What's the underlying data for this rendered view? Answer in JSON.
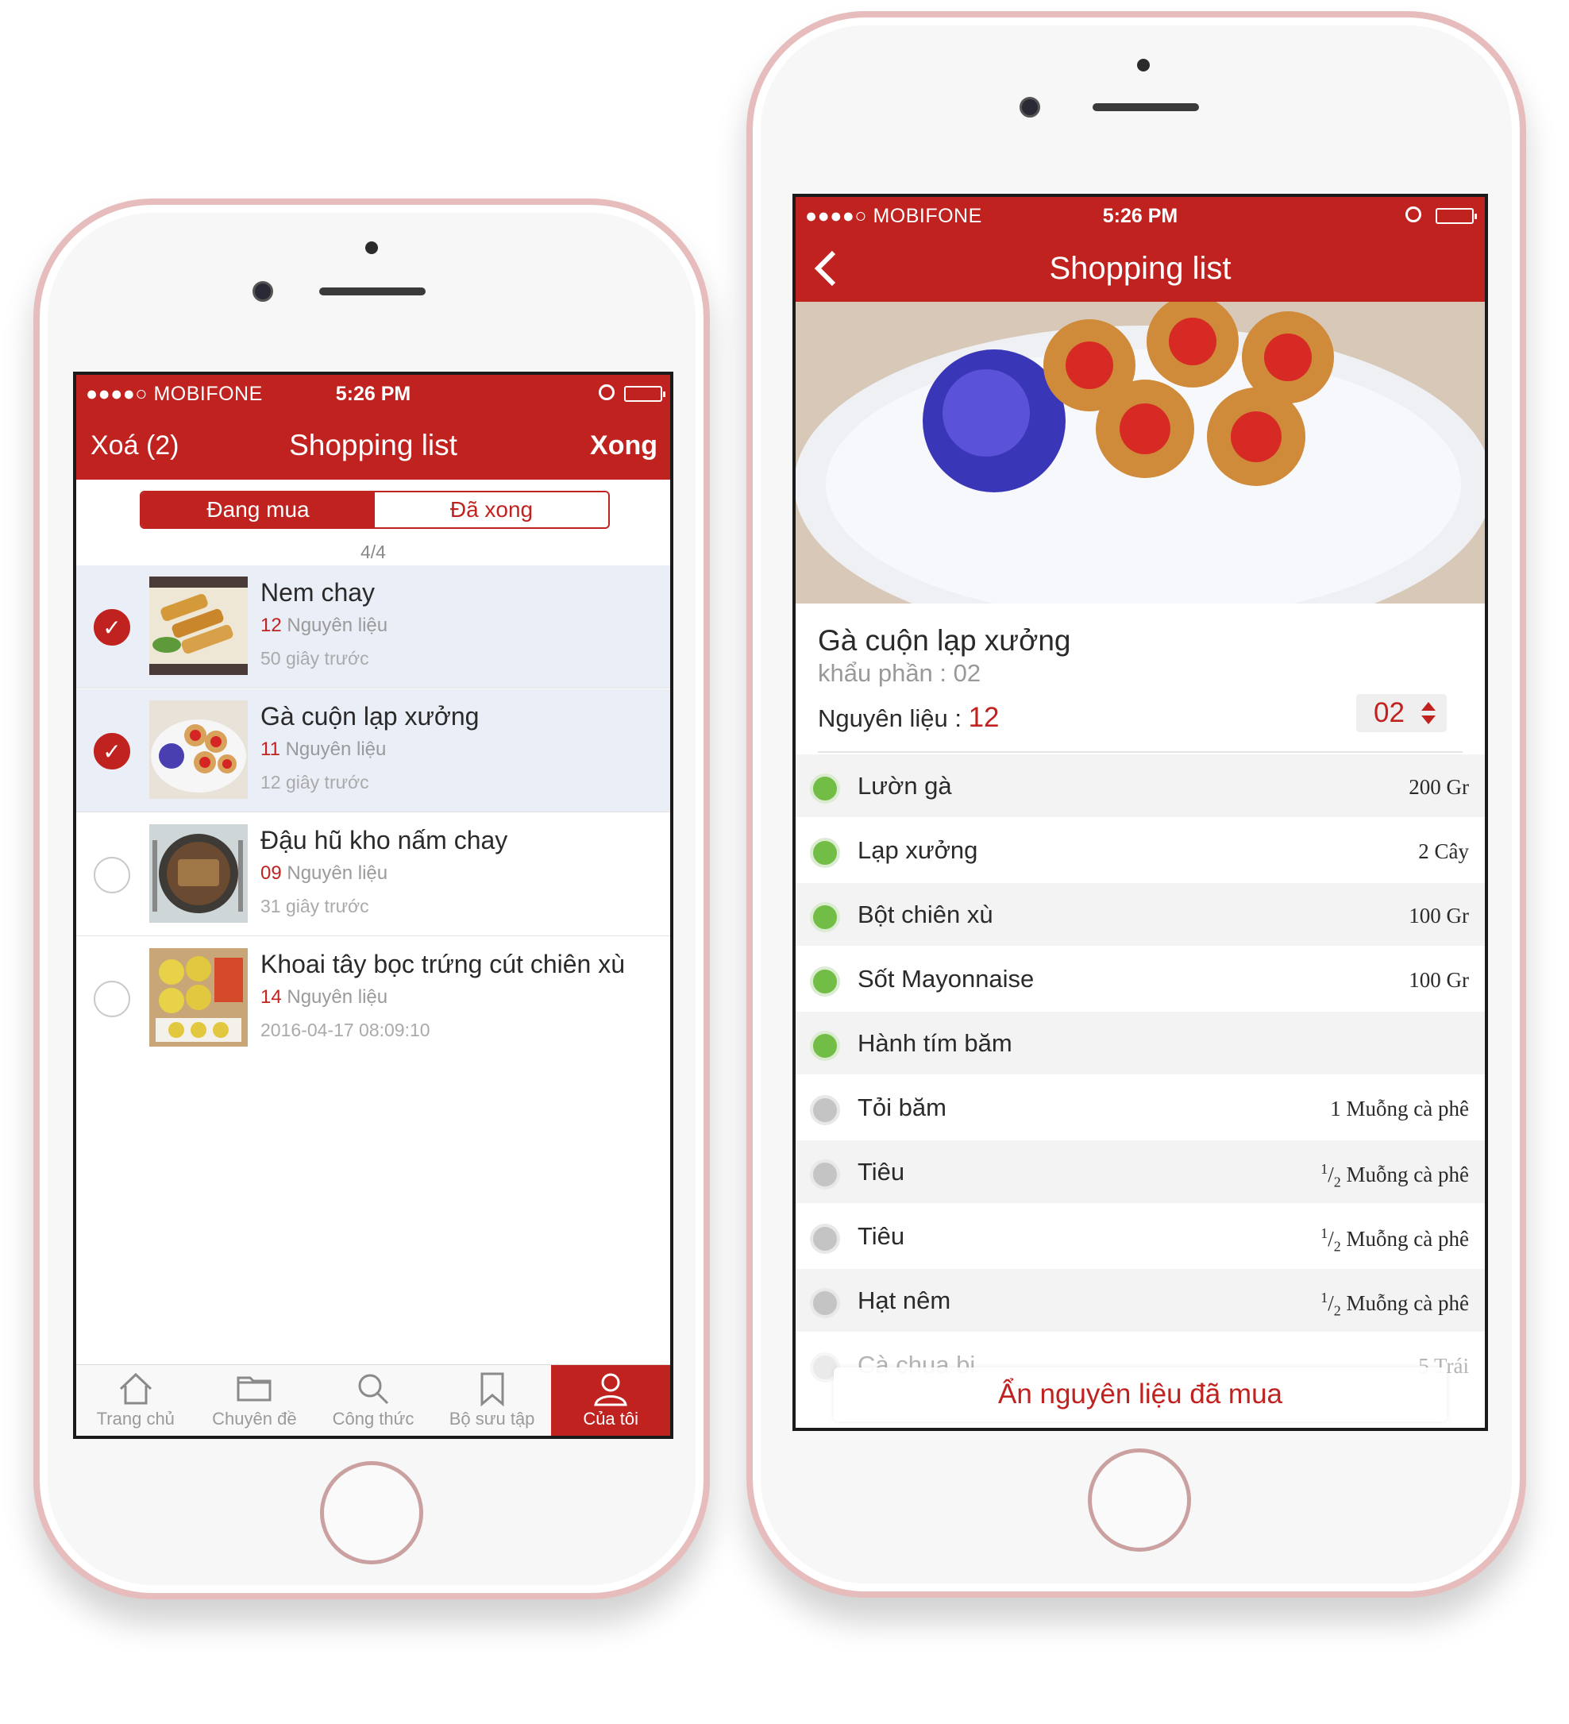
{
  "left": {
    "status": {
      "carrier": "●●●●○ MOBIFONE",
      "time": "5:26 PM"
    },
    "nav": {
      "left": "Xoá (2)",
      "title": "Shopping list",
      "right": "Xong"
    },
    "segments": [
      "Đang mua",
      "Đã xong"
    ],
    "count": "4/4",
    "items": [
      {
        "title": "Nem chay",
        "num": "12",
        "unit": "Nguyên liệu",
        "time": "50 giây trước",
        "checked": true
      },
      {
        "title": "Gà cuộn lạp xưởng",
        "num": "11",
        "unit": "Nguyên liệu",
        "time": "12 giây trước",
        "checked": true
      },
      {
        "title": "Đậu hũ kho nấm chay",
        "num": "09",
        "unit": "Nguyên liệu",
        "time": "31 giây trước",
        "checked": false
      },
      {
        "title": "Khoai tây bọc trứng cút chiên xù",
        "num": "14",
        "unit": "Nguyên liệu",
        "time": "2016-04-17 08:09:10",
        "checked": false
      }
    ],
    "tabs": [
      "Trang chủ",
      "Chuyên đề",
      "Công thức",
      "Bộ sưu tập",
      "Của tôi"
    ]
  },
  "right": {
    "status": {
      "carrier": "●●●●○ MOBIFONE",
      "time": "5:26 PM"
    },
    "nav": {
      "title": "Shopping list"
    },
    "recipe": {
      "title": "Gà cuộn lạp xưởng",
      "serving": "khẩu phần : 02",
      "ing_label": "Nguyên liệu : ",
      "ing_count": "12",
      "stepper": "02"
    },
    "ingredients": [
      {
        "name": "Lườn gà",
        "qty": "200 Gr",
        "state": "green"
      },
      {
        "name": "Lạp xưởng",
        "qty": "2 Cây",
        "state": "green"
      },
      {
        "name": "Bột chiên xù",
        "qty": "100 Gr",
        "state": "green"
      },
      {
        "name": "Sốt Mayonnaise",
        "qty": "100 Gr",
        "state": "green"
      },
      {
        "name": "Hành tím băm",
        "qty": "",
        "state": "green"
      },
      {
        "name": "Tỏi băm",
        "qty": "1 Muỗng cà phê",
        "state": "gray"
      },
      {
        "name": "Tiêu",
        "qty_sup": "1",
        "qty_sub": "2",
        "qty": "Muỗng cà phê",
        "state": "gray"
      },
      {
        "name": "Tiêu",
        "qty_sup": "1",
        "qty_sub": "2",
        "qty": "Muỗng cà phê",
        "state": "gray"
      },
      {
        "name": "Hạt nêm",
        "qty_sup": "1",
        "qty_sub": "2",
        "qty": "Muỗng cà phê",
        "state": "gray"
      },
      {
        "name": "Cà chua bi",
        "qty": "5 Trái",
        "state": "gray"
      }
    ],
    "hide_button": "Ẩn nguyên liệu đã mua"
  },
  "colors": {
    "brand_red": "#c0221f",
    "green": "#72bd45"
  }
}
